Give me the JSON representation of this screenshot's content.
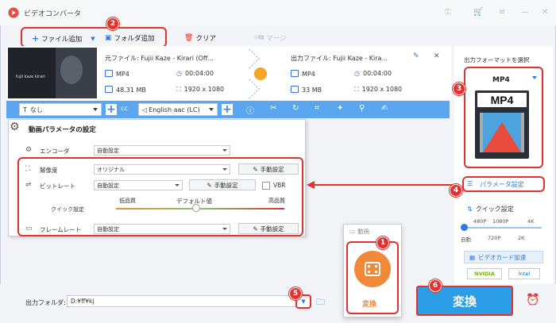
{
  "app": {
    "title": "ビデオコンバータ"
  },
  "toolbar": {
    "add_file": "ファイル追加",
    "add_folder": "フォルダ追加",
    "clear": "クリア",
    "merge": "マージ",
    "gpu": "GPU"
  },
  "file": {
    "source_name": "元ファイル: Fujii Kaze - Kirari (Off...",
    "source_format": "MP4",
    "source_duration": "00:04:00",
    "source_size": "48.31 MB",
    "source_resolution": "1920 x 1080",
    "output_name": "出力ファイル: Fujii Kaze - Kira...",
    "output_format": "MP4",
    "output_duration": "00:04:00",
    "output_size": "33 MB",
    "output_resolution": "1920 x 1080",
    "thumb_text": "fujii kaze kirari"
  },
  "bluebar": {
    "subtitle": "なし",
    "audio": "English aac (LC)"
  },
  "params": {
    "title": "動画パラメータの設定",
    "encoder_label": "エンコーダ",
    "encoder_value": "自動設定",
    "resolution_label": "解像度",
    "resolution_value": "オリジナル",
    "bitrate_label": "ビットレート",
    "bitrate_value": "自動設定",
    "vbr": "VBR",
    "quick_label": "クイック設定",
    "low": "低品質",
    "default": "デフォルト値",
    "high": "高品質",
    "framerate_label": "フレームレート",
    "framerate_value": "自動設定",
    "manual": "手動設定"
  },
  "right": {
    "output_format_label": "出力フォーマットを選択",
    "format_name": "MP4",
    "param_settings": "パラメータ設定",
    "quick_settings": "クイック設定",
    "ticks_top": [
      "480P",
      "1080P",
      "4K"
    ],
    "ticks_bottom": [
      "自動",
      "720P",
      "2K"
    ],
    "hw_accel": "ビデオカード加速",
    "nvidia": "NVIDIA",
    "intel": "Intel"
  },
  "popup": {
    "tab": "動画",
    "convert": "変換"
  },
  "bottom": {
    "output_folder_label": "出力フォルダ:",
    "output_folder_value": "D:¥ff¥kj",
    "convert": "変換"
  },
  "markers": [
    "1",
    "2",
    "3",
    "4",
    "5",
    "6"
  ],
  "colors": {
    "accent": "#2c9ee8",
    "highlight": "#e0322e",
    "popup_orange": "#f08a3a"
  }
}
